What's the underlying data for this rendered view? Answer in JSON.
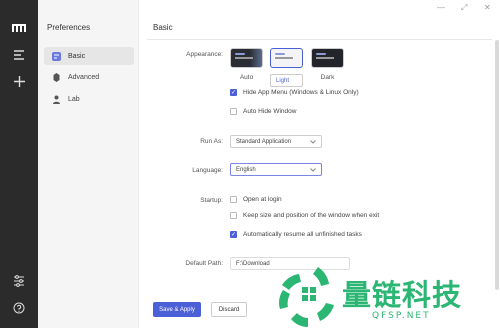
{
  "app": {
    "title": "Preferences"
  },
  "window_controls": [
    "—",
    "⤢",
    "✕"
  ],
  "sidebar": {
    "items": [
      {
        "label": "Basic",
        "active": true
      },
      {
        "label": "Advanced",
        "active": false
      },
      {
        "label": "Lab",
        "active": false
      }
    ]
  },
  "main": {
    "section_title": "Basic",
    "appearance": {
      "label": "Appearance:",
      "options": [
        {
          "caption": "Auto",
          "selected": false
        },
        {
          "caption": "Light",
          "selected": true
        },
        {
          "caption": "Dark",
          "selected": false
        }
      ],
      "hide_app_menu": {
        "label": "Hide App Menu (Windows & Linux Only)",
        "checked": true
      },
      "auto_hide_window": {
        "label": "Auto Hide Window",
        "checked": false
      }
    },
    "run_as": {
      "label": "Run As:",
      "value": "Standard Application"
    },
    "language": {
      "label": "Language:",
      "value": "English"
    },
    "startup": {
      "label": "Startup:",
      "open_at_login": {
        "label": "Open at login",
        "checked": false
      },
      "keep_size": {
        "label": "Keep size and position of the window when exit",
        "checked": false
      },
      "auto_resume": {
        "label": "Automatically resume all unfinished tasks",
        "checked": true
      }
    },
    "default_path": {
      "label": "Default Path:",
      "value": "F:\\Download"
    }
  },
  "footer": {
    "save_label": "Save & Apply",
    "discard_label": "Discard"
  },
  "watermark": {
    "text": "量链科技",
    "sub": "QFSP.NET"
  },
  "colors": {
    "accent": "#4b5fd6",
    "rail": "#2b2b2b",
    "sidebar": "#f5f5f5",
    "watermark": "#2bb673"
  }
}
